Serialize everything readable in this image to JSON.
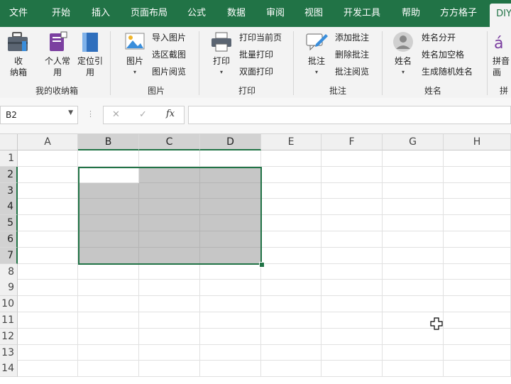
{
  "tabs": [
    "文件",
    "开始",
    "插入",
    "页面布局",
    "公式",
    "数据",
    "审阅",
    "视图",
    "开发工具",
    "帮助",
    "方方格子",
    "DIY"
  ],
  "ribbon": {
    "groups": {
      "box": {
        "label": "我的收纳箱",
        "collect": "收\n纳箱",
        "personal": "个人常\n用",
        "locate": "定位引\n用"
      },
      "picture": {
        "label": "图片",
        "picture_btn": "图片",
        "import": "导入图片",
        "screenshot": "选区截图",
        "preview": "图片阅览"
      },
      "print": {
        "label": "打印",
        "print_btn": "打印",
        "current": "打印当前页",
        "batch": "批量打印",
        "duplex": "双面打印"
      },
      "comment": {
        "label": "批注",
        "comment_btn": "批注",
        "add": "添加批注",
        "delete": "删除批注",
        "view": "批注阅览"
      },
      "name": {
        "label": "姓名",
        "name_btn": "姓名",
        "split": "姓名分开",
        "space": "姓名加空格",
        "random": "生成随机姓名"
      },
      "pinyin": {
        "label": "拼",
        "btn": "拼音\n画"
      }
    }
  },
  "formula_bar": {
    "name_box": "B2",
    "cancel": "✕",
    "enter": "✓",
    "fx": "fx",
    "formula": ""
  },
  "sheet": {
    "columns": [
      "A",
      "B",
      "C",
      "D",
      "E",
      "F",
      "G",
      "H"
    ],
    "rows": [
      "1",
      "2",
      "3",
      "4",
      "5",
      "6",
      "7",
      "8",
      "9",
      "10",
      "11",
      "12",
      "13",
      "14"
    ],
    "selected_range": "B2:D7",
    "active_cell": "B2"
  },
  "colors": {
    "accent": "#217346",
    "selection": "#c6c6c6"
  },
  "icons": [
    "briefcase-icon",
    "personal-icon",
    "bookmark-icon",
    "picture-icon",
    "printer-icon",
    "comment-icon",
    "person-icon",
    "pinyin-icon",
    "cross-cursor-icon"
  ]
}
